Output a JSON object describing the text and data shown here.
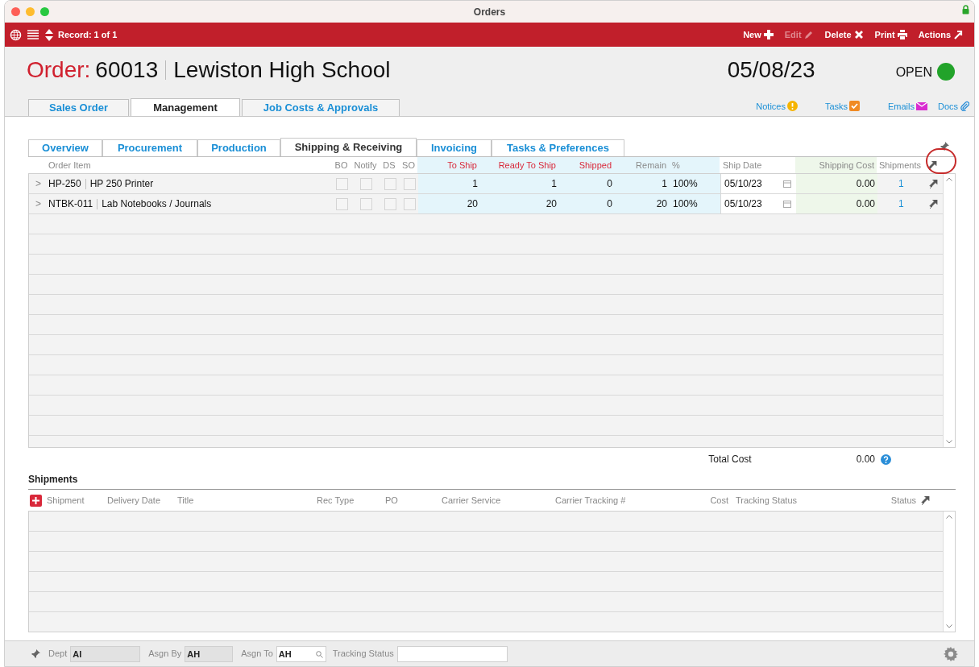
{
  "window": {
    "title": "Orders"
  },
  "toolbar": {
    "record": "Record: 1 of 1",
    "buttons": [
      {
        "label": "New",
        "kind": "new",
        "disabled": false
      },
      {
        "label": "Edit",
        "kind": "edit",
        "disabled": true
      },
      {
        "label": "Delete",
        "kind": "delete",
        "disabled": false
      },
      {
        "label": "Print",
        "kind": "print",
        "disabled": false
      },
      {
        "label": "Actions",
        "kind": "actions",
        "disabled": false
      }
    ]
  },
  "header": {
    "label": "Order:",
    "number": "60013",
    "customer": "Lewiston High School",
    "date": "05/08/23",
    "status": "OPEN",
    "status_dot": {
      "color": "#22a32a"
    }
  },
  "tabs": [
    {
      "label": "Sales Order",
      "selected": false
    },
    {
      "label": "Management",
      "selected": true
    },
    {
      "label": "Job Costs & Approvals",
      "selected": false
    }
  ],
  "links": [
    {
      "label": "Notices",
      "kind": "notices"
    },
    {
      "label": "Tasks",
      "kind": "tasks"
    },
    {
      "label": "Emails",
      "kind": "emails"
    },
    {
      "label": "Docs",
      "kind": "docs"
    }
  ],
  "subtabs": [
    {
      "label": "Overview",
      "selected": false
    },
    {
      "label": "Procurement",
      "selected": false
    },
    {
      "label": "Production",
      "selected": false
    },
    {
      "label": "Shipping & Receiving",
      "selected": true
    },
    {
      "label": "Invoicing",
      "selected": false
    },
    {
      "label": "Tasks & Preferences",
      "selected": false
    }
  ],
  "items": {
    "columns": [
      {
        "label": "Order Item",
        "kind": "plain"
      },
      {
        "label": "BO",
        "kind": "plain"
      },
      {
        "label": "Notify",
        "kind": "plain"
      },
      {
        "label": "DS",
        "kind": "plain"
      },
      {
        "label": "SO",
        "kind": "plain"
      },
      {
        "label": "To Ship",
        "kind": "quantity"
      },
      {
        "label": "Ready To Ship",
        "kind": "quantity"
      },
      {
        "label": "Shipped",
        "kind": "quantity"
      },
      {
        "label": "Remain",
        "kind": "plain"
      },
      {
        "label": "%",
        "kind": "plain"
      },
      {
        "label": "Ship Date",
        "kind": "plain"
      },
      {
        "label": "Shipping Cost",
        "kind": "plain"
      },
      {
        "label": "Shipments",
        "kind": "plain"
      }
    ],
    "rows": [
      {
        "expander": ">",
        "code": "HP-250",
        "name": "HP 250 Printer",
        "bo": false,
        "notify": false,
        "ds": false,
        "so": false,
        "to_ship": "1",
        "ready": "1",
        "shipped": "0",
        "remain": "1",
        "pct": "100%",
        "ship_date": "05/10/23",
        "shipping_cost": "0.00",
        "shipments": "1"
      },
      {
        "expander": ">",
        "code": "NTBK-011",
        "name": "Lab Notebooks / Journals",
        "bo": false,
        "notify": false,
        "ds": false,
        "so": false,
        "to_ship": "20",
        "ready": "20",
        "shipped": "0",
        "remain": "20",
        "pct": "100%",
        "ship_date": "05/10/23",
        "shipping_cost": "0.00",
        "shipments": "1"
      }
    ],
    "total_label": "Total Cost",
    "total_value": "0.00"
  },
  "shipments": {
    "title": "Shipments",
    "columns": [
      "Shipment",
      "Delivery Date",
      "Title",
      "Rec Type",
      "PO",
      "Carrier Service",
      "Carrier Tracking #",
      "Cost",
      "Tracking Status",
      "Status"
    ]
  },
  "footer": {
    "fields": [
      {
        "label": "Dept",
        "value": "AI",
        "disabled": true,
        "kind": "text"
      },
      {
        "label": "Asgn By",
        "value": "AH",
        "disabled": true,
        "kind": "text"
      },
      {
        "label": "Asgn To",
        "value": "AH",
        "disabled": false,
        "kind": "lookup"
      },
      {
        "label": "Tracking Status",
        "disabled": false,
        "kind": "text"
      }
    ]
  }
}
